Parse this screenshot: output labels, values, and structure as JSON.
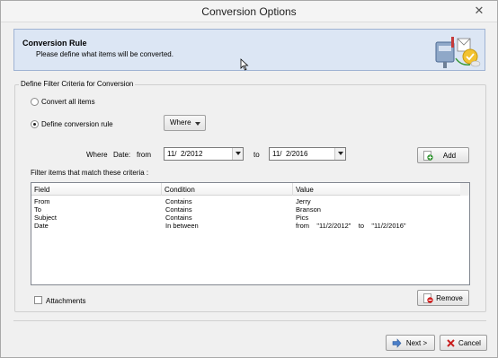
{
  "window": {
    "title": "Conversion Options",
    "close_glyph": "✕"
  },
  "header": {
    "title": "Conversion Rule",
    "subtitle": "Please define what items will be converted.",
    "icon": "mailbox-convert-icon"
  },
  "filter_group": {
    "legend": "Define Filter Criteria for Conversion",
    "option_all_label": "Convert all items",
    "option_rule_label": "Define conversion rule",
    "selected_option": "rule",
    "where_button_label": "Where",
    "where_label": "Where",
    "field_label": "Date:",
    "from_label": "from",
    "from_value": "11/  2/2012",
    "to_label": "to",
    "to_value": "11/  2/2016",
    "add_button_label": "Add",
    "criteria_caption": "Filter items that match these criteria :"
  },
  "criteria_table": {
    "columns": [
      "Field",
      "Condition",
      "Value"
    ],
    "rows": [
      [
        "From",
        "Contains",
        "Jerry"
      ],
      [
        "To",
        "Contains",
        "Branson"
      ],
      [
        "Subject",
        "Contains",
        "Pics"
      ],
      [
        "Date",
        "In between",
        "from    \"11/2/2012\"    to    \"11/2/2016\""
      ]
    ]
  },
  "attachments_label": "Attachments",
  "attachments_checked": false,
  "remove_button_label": "Remove",
  "footer": {
    "next_button_label": "Next >",
    "cancel_button_label": "Cancel"
  },
  "colors": {
    "header_bg": "#dce6f4",
    "header_border": "#9fb3d3",
    "add_icon_green": "#3a9a3a",
    "remove_icon_red": "#d02020",
    "cancel_icon_red": "#c81e1e"
  }
}
